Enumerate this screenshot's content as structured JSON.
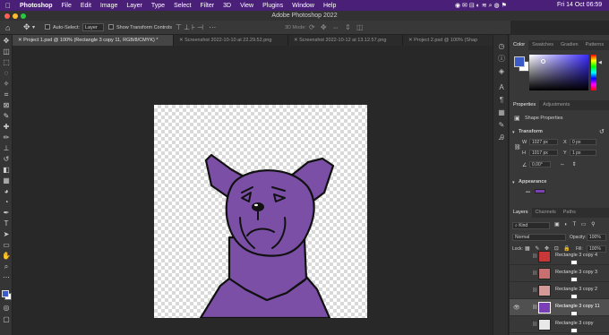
{
  "menubar": {
    "app": "Photoshop",
    "items": [
      "File",
      "Edit",
      "Image",
      "Layer",
      "Type",
      "Select",
      "Filter",
      "3D",
      "View",
      "Plugins",
      "Window",
      "Help"
    ],
    "clock": "Fri 14 Oct  06:59"
  },
  "window": {
    "title": "Adobe Photoshop 2022"
  },
  "options": {
    "auto_select_label": "Auto-Select:",
    "auto_select_value": "Layer",
    "show_transform_label": "Show Transform Controls",
    "mode_3d_label": "3D Mode:"
  },
  "tabs": [
    {
      "label": "Project 1.psd @ 100% (Rectangle 3 copy 11, RGB/8/CMYK) *",
      "active": true
    },
    {
      "label": "Screenshot 2022-10-10 at 22.29.52.png",
      "active": false
    },
    {
      "label": "Screenshot 2022-10-12 at 13.12.57.png",
      "active": false
    },
    {
      "label": "Project 2.psd @ 100% (Shap",
      "active": false
    }
  ],
  "color_panel": {
    "tabs": [
      "Color",
      "Swatches",
      "Gradien",
      "Patterns"
    ],
    "foreground": "#3a5bc7",
    "background": "#ffffff"
  },
  "properties_panel": {
    "tabs": [
      "Properties",
      "Adjustments"
    ],
    "kind": "Shape Properties",
    "transform_label": "Transform",
    "w_label": "W",
    "w_value": "1027 px",
    "h_label": "H",
    "h_value": "1017 px",
    "x_label": "X",
    "x_value": "0 px",
    "y_label": "Y",
    "y_value": "1 px",
    "angle_value": "0.00°",
    "appearance_label": "Appearance",
    "fill_color": "#7b3fb5"
  },
  "layers_panel": {
    "tabs": [
      "Layers",
      "Channels",
      "Paths"
    ],
    "filter_label": "Kind",
    "blend_mode": "Normal",
    "opacity_label": "Opacity:",
    "opacity_value": "100%",
    "lock_label": "Lock:",
    "fill_label": "Fill:",
    "fill_value": "100%",
    "layers": [
      {
        "name": "Rectangle 3 copy 4",
        "thumb": "#c83838",
        "selected": false,
        "visible": false
      },
      {
        "name": "Rectangle 3 copy 3",
        "thumb": "#c87070",
        "selected": false,
        "visible": false
      },
      {
        "name": "Rectangle 3 copy 2",
        "thumb": "#d49a9a",
        "selected": false,
        "visible": false
      },
      {
        "name": "Rectangle 3 copy 11",
        "thumb": "#7b3fb5",
        "selected": true,
        "visible": true
      },
      {
        "name": "Rectangle 3 copy",
        "thumb": "#e8e8e8",
        "selected": false,
        "visible": false
      }
    ]
  },
  "artwork": {
    "fill": "#7b4fa6",
    "stroke": "#111111"
  }
}
